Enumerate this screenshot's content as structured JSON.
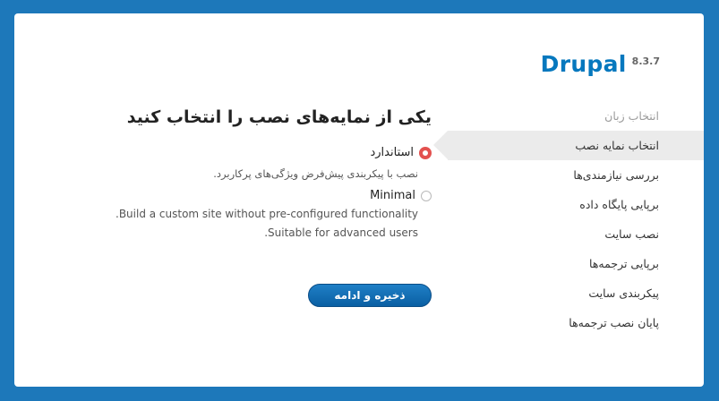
{
  "brand": {
    "name": "Drupal",
    "version": "8.3.7"
  },
  "steps": [
    {
      "label": "انتخاب زبان",
      "state": "done"
    },
    {
      "label": "انتخاب نمایه نصب",
      "state": "active"
    },
    {
      "label": "بررسی نیازمندی‌ها",
      "state": "pending"
    },
    {
      "label": "برپایی پایگاه داده",
      "state": "pending"
    },
    {
      "label": "نصب سایت",
      "state": "pending"
    },
    {
      "label": "برپایی ترجمه‌ها",
      "state": "pending"
    },
    {
      "label": "پیکربندی سایت",
      "state": "pending"
    },
    {
      "label": "پایان نصب ترجمه‌ها",
      "state": "pending"
    }
  ],
  "main": {
    "title": "یکی از نمایه‌های نصب را انتخاب کنید",
    "options": [
      {
        "label": "استاندارد",
        "description": "نصب با پیکربندی پیش‌فرض ویژگی‌های پرکاربرد.",
        "checked": true
      },
      {
        "label": "Minimal",
        "description_lines": [
          "Build a custom site without pre-configured functionality.",
          "Suitable for advanced users."
        ],
        "checked": false
      }
    ],
    "submit_label": "ذخیره و ادامه"
  },
  "colors": {
    "background": "#1d78ba",
    "brand": "#0678be",
    "radio_checked": "#e3514f",
    "button": "#0a6ab2"
  }
}
